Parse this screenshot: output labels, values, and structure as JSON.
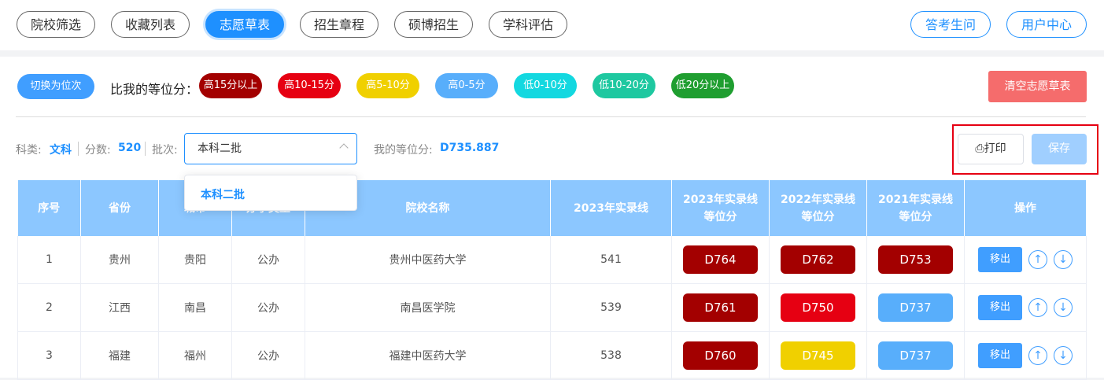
{
  "nav": {
    "items": [
      "院校筛选",
      "收藏列表",
      "志愿草表",
      "招生章程",
      "硕博招生",
      "学科评估"
    ],
    "active": "志愿草表",
    "right": [
      "答考生问",
      "用户中心"
    ]
  },
  "filters": {
    "toggle_label": "切换为位次",
    "compare_label": "比我的等位分：",
    "chips": [
      {
        "label": "高15分以上",
        "color": "#a30000"
      },
      {
        "label": "高10-15分",
        "color": "#e60012"
      },
      {
        "label": "高5-10分",
        "color": "#f0d000"
      },
      {
        "label": "高0-5分",
        "color": "#58aefb"
      },
      {
        "label": "低0-10分",
        "color": "#13d8e0"
      },
      {
        "label": "低10-20分",
        "color": "#1ec8a0"
      },
      {
        "label": "低20分以上",
        "color": "#1f9e30"
      }
    ],
    "clear_label": "清空志愿草表"
  },
  "info": {
    "subject_label": "科类:",
    "subject_value": "文科",
    "score_label": "分数:",
    "score_value": "520",
    "batch_label": "批次:",
    "batch_selected": "本科二批",
    "batch_option": "本科二批",
    "equiv_label": "我的等位分:",
    "equiv_value": "D735.887"
  },
  "actions": {
    "print_label": "打印",
    "save_label": "保存"
  },
  "table": {
    "headers": [
      "序号",
      "省份",
      "城市",
      "办学类型",
      "院校名称",
      "2023年实录线",
      "2023年实录线\n等位分",
      "2022年实录线\n等位分",
      "2021年实录线\n等位分",
      "操作"
    ],
    "remove_label": "移出",
    "rows": [
      {
        "no": "1",
        "province": "贵州",
        "city": "贵阳",
        "type": "公办",
        "school": "贵州中医药大学",
        "line2023": "541",
        "d2023": {
          "text": "D764",
          "color": "#a30000"
        },
        "d2022": {
          "text": "D762",
          "color": "#a30000"
        },
        "d2021": {
          "text": "D753",
          "color": "#a30000"
        }
      },
      {
        "no": "2",
        "province": "江西",
        "city": "南昌",
        "type": "公办",
        "school": "南昌医学院",
        "line2023": "539",
        "d2023": {
          "text": "D761",
          "color": "#a30000"
        },
        "d2022": {
          "text": "D750",
          "color": "#e60012"
        },
        "d2021": {
          "text": "D737",
          "color": "#58aefb"
        }
      },
      {
        "no": "3",
        "province": "福建",
        "city": "福州",
        "type": "公办",
        "school": "福建中医药大学",
        "line2023": "538",
        "d2023": {
          "text": "D760",
          "color": "#a30000"
        },
        "d2022": {
          "text": "D745",
          "color": "#f0d000"
        },
        "d2021": {
          "text": "D737",
          "color": "#58aefb"
        }
      }
    ]
  }
}
